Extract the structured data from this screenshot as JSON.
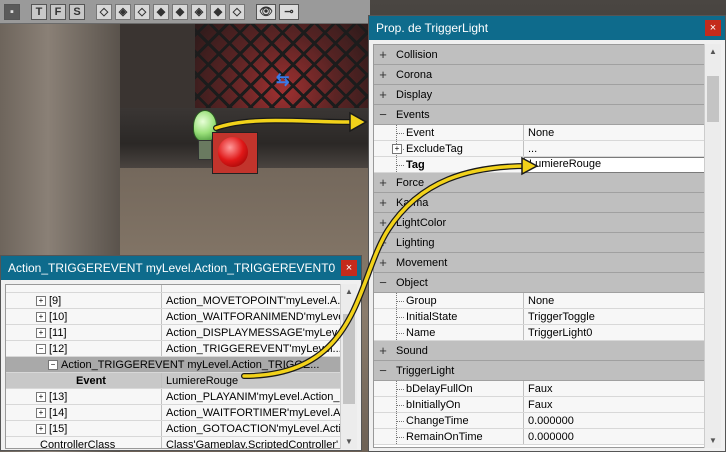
{
  "toolbar": {
    "letters": [
      "T",
      "F",
      "S"
    ]
  },
  "props_window": {
    "title": "Prop. de TriggerLight",
    "close_glyph": "×",
    "categories": {
      "collision": "Collision",
      "corona": "Corona",
      "display": "Display",
      "events": "Events",
      "force": "Force",
      "karma": "Karma",
      "lightcolor": "LightColor",
      "lighting": "Lighting",
      "movement": "Movement",
      "object": "Object",
      "sound": "Sound",
      "triggerlight": "TriggerLight"
    },
    "events": [
      {
        "name": "Event",
        "value": "None"
      },
      {
        "name": "ExcludeTag",
        "value": "..."
      },
      {
        "name": "Tag",
        "value": "LumiereRouge"
      }
    ],
    "object": [
      {
        "name": "Group",
        "value": "None"
      },
      {
        "name": "InitialState",
        "value": "TriggerToggle"
      },
      {
        "name": "Name",
        "value": "TriggerLight0"
      }
    ],
    "triggerlight": [
      {
        "name": "bDelayFullOn",
        "value": "Faux"
      },
      {
        "name": "bInitiallyOn",
        "value": "Faux"
      },
      {
        "name": "ChangeTime",
        "value": "0.000000"
      },
      {
        "name": "RemainOnTime",
        "value": "0.000000"
      }
    ]
  },
  "action_window": {
    "title": "Action_TRIGGEREVENT myLevel.Action_TRIGGEREVENT0",
    "close_glyph": "×",
    "rows": [
      {
        "name": "[9]",
        "value": "Action_MOVETOPOINT'myLevel.A..."
      },
      {
        "name": "[10]",
        "value": "Action_WAITFORANIMEND'myLeve..."
      },
      {
        "name": "[11]",
        "value": "Action_DISPLAYMESSAGE'myLev..."
      },
      {
        "name": "[12]",
        "value": "Action_TRIGGEREVENT'myLevel...."
      }
    ],
    "expanded_row": "Action_TRIGGEREVENT myLevel.Action_TRIGGE...",
    "event_row": {
      "name": "Event",
      "value": "LumiereRouge"
    },
    "rows_after": [
      {
        "name": "[13]",
        "value": "Action_PLAYANIM'myLevel.Action_..."
      },
      {
        "name": "[14]",
        "value": "Action_WAITFORTIMER'myLevel.A..."
      },
      {
        "name": "[15]",
        "value": "Action_GOTOACTION'myLevel.Acti..."
      }
    ],
    "controller": {
      "name": "ControllerClass",
      "value": "Class'Gameplay.ScriptedController'"
    }
  },
  "colors": {
    "titlebar": "#0e6b8c",
    "close": "#c42b1c",
    "arrow": "#f2d21a"
  }
}
